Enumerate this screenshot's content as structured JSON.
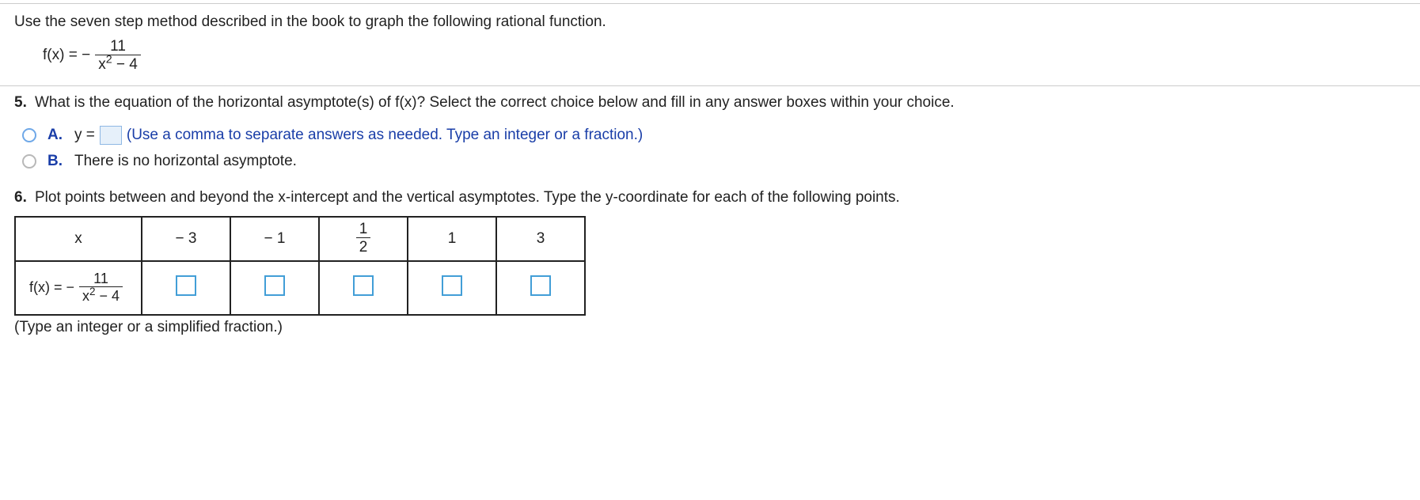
{
  "intro": "Use the seven step method described in the book to graph the following rational function.",
  "fn": {
    "lhs": "f(x) = −",
    "num": "11",
    "den_base": "x",
    "den_exp": "2",
    "den_rest": " − 4"
  },
  "q5": {
    "num": "5.",
    "text": "What is the equation of the horizontal asymptote(s) of f(x)? Select the correct choice below and fill in any answer boxes within your choice."
  },
  "choice_a": {
    "label": "A.",
    "pre": "y =",
    "hint": "(Use a comma to separate answers as needed. Type an integer or a fraction.)"
  },
  "choice_b": {
    "label": "B.",
    "text": "There is no horizontal asymptote."
  },
  "q6": {
    "num": "6.",
    "text": "Plot points between and beyond the x-intercept and the vertical asymptotes. Type the y-coordinate for each of the following points."
  },
  "table": {
    "header_x": "x",
    "cols": [
      "− 3",
      "− 1",
      "",
      "1",
      "3"
    ],
    "frac_col": {
      "num": "1",
      "den": "2"
    },
    "row2_lhs": "f(x) = −",
    "row2_num": "11",
    "row2_den_base": "x",
    "row2_den_exp": "2",
    "row2_den_rest": " − 4"
  },
  "note": "(Type an integer or a simplified fraction.)"
}
